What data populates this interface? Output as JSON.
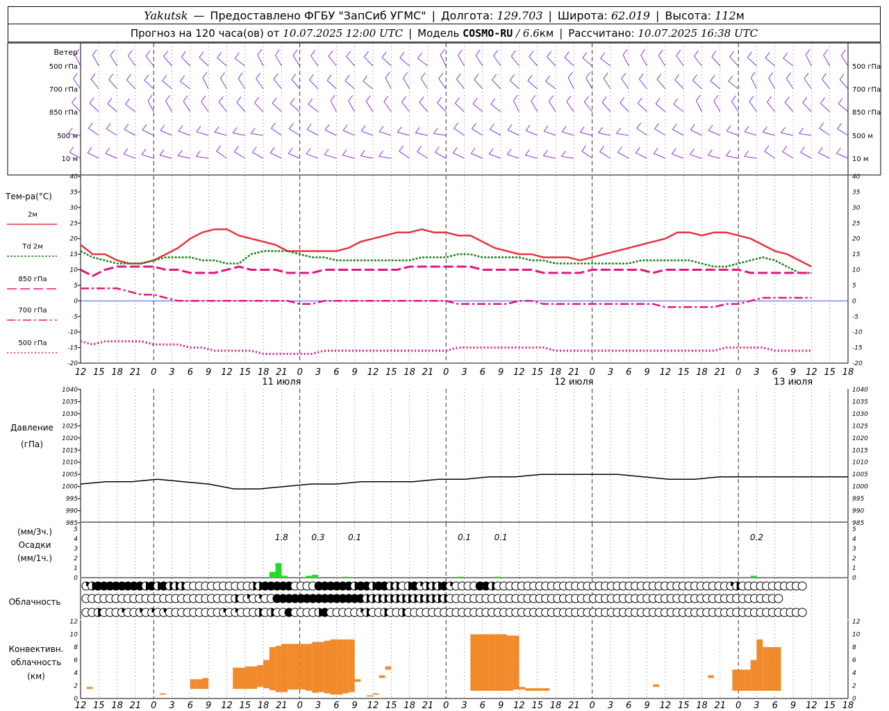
{
  "header": {
    "station": "Yakutsk",
    "dash": "—",
    "provider": "Предоставлено ФГБУ \"ЗапСиб УГМС\"",
    "lon_label": "Долгота:",
    "lon_value": "129.703",
    "lat_label": "Широта:",
    "lat_value": "62.019",
    "alt_label": "Высота:",
    "alt_value": "112",
    "alt_unit": "м",
    "forecast_label": "Прогноз на 120 часа(ов) от",
    "forecast_start": "10.07.2025 12:00 UTC",
    "model_label": "Модель",
    "model_name": "COSMO-RU",
    "model_res": "/ 6.6",
    "model_res_unit": "км",
    "calc_label": "Рассчитано:",
    "calc_time": "10.07.2025 16:38 UTC"
  },
  "colors": {
    "wind": "#8a2be2",
    "t2m": "#e8323c",
    "td2m": "#1a7f1a",
    "t850": "#e0157a",
    "t700": "#e0157a",
    "t500": "#e0157a",
    "zero_line": "#3030ff",
    "pressure": "#000000",
    "precip": "#22dd22",
    "convective": "#f08a2a",
    "grid": "#000000"
  },
  "wind_panel": {
    "title": "Ветер",
    "levels": [
      "500 гПа",
      "700 гПа",
      "850 гПа",
      "500  м",
      "10  м"
    ]
  },
  "temp_panel": {
    "title": "Тем-ра(°С)",
    "legend": [
      {
        "label": "2м",
        "style": "solid"
      },
      {
        "label": "Td  2м",
        "style": "dotted"
      },
      {
        "label": "850 гПа",
        "style": "dash"
      },
      {
        "label": "700 гПа",
        "style": "dashdot"
      },
      {
        "label": "500 гПа",
        "style": "fine"
      }
    ]
  },
  "pressure_panel": {
    "title": "Давление",
    "unit": "(гПа)"
  },
  "precip_panel": {
    "unit1": "(мм/3ч.)",
    "title": "Осадки",
    "unit2": "(мм/1ч.)"
  },
  "cloud_panel": {
    "title": "Облачность"
  },
  "conv_panel": {
    "title1": "Конвективн.",
    "title2": "облачность",
    "unit": "(км)"
  },
  "chart_data": {
    "type": "line",
    "x_hours": [
      0,
      3,
      6,
      9,
      12,
      15,
      18,
      21,
      24,
      27,
      30,
      33,
      36,
      39,
      42,
      45,
      48,
      51,
      54,
      57,
      60,
      63,
      66,
      69,
      72,
      75,
      78,
      81,
      84,
      87,
      90,
      93,
      96,
      99,
      102,
      105,
      108,
      111,
      114,
      117,
      120
    ],
    "x_tick_labels": [
      "12",
      "15",
      "18",
      "21",
      "0",
      "3",
      "6",
      "9",
      "12",
      "15",
      "18",
      "21",
      "0",
      "3",
      "6",
      "9",
      "12",
      "15",
      "18",
      "21",
      "0",
      "3",
      "6",
      "9",
      "12",
      "15",
      "18",
      "21",
      "0",
      "3",
      "6",
      "9",
      "12",
      "15",
      "18",
      "21",
      "0",
      "3",
      "6",
      "9",
      "12",
      "15",
      "18"
    ],
    "day_labels": [
      "11 июля",
      "12 июля",
      "13 июля"
    ],
    "temperature": {
      "ylim": [
        -20,
        40
      ],
      "yticks": [
        -20,
        -15,
        -10,
        -5,
        0,
        5,
        10,
        15,
        20,
        25,
        30,
        35,
        40
      ],
      "series": [
        {
          "name": "2м",
          "values": [
            18,
            15,
            15,
            13,
            12,
            12,
            13,
            15,
            17,
            20,
            22,
            23,
            23,
            21,
            20,
            19,
            18,
            16,
            16,
            16,
            16,
            16,
            17,
            19,
            20,
            21,
            22,
            22,
            23,
            22,
            22,
            21,
            21,
            19,
            17,
            16,
            15,
            15,
            14,
            14,
            14,
            13,
            14,
            15,
            16,
            17,
            18,
            19,
            20,
            22,
            22,
            21,
            22,
            22,
            21,
            20,
            18,
            16,
            15,
            13,
            11
          ]
        },
        {
          "name": "Td  2м",
          "values": [
            16,
            14,
            13,
            12,
            12,
            12,
            13,
            14,
            14,
            14,
            13,
            13,
            12,
            12,
            15,
            16,
            16,
            16,
            15,
            14,
            14,
            13,
            13,
            13,
            13,
            13,
            13,
            13,
            14,
            14,
            14,
            15,
            15,
            14,
            14,
            14,
            14,
            13,
            13,
            12,
            12,
            12,
            12,
            12,
            12,
            12,
            13,
            13,
            13,
            13,
            13,
            12,
            11,
            11,
            12,
            13,
            14,
            13,
            11,
            9,
            9
          ]
        },
        {
          "name": "850 гПа",
          "values": [
            10,
            8,
            10,
            11,
            11,
            11,
            11,
            10,
            10,
            9,
            9,
            9,
            10,
            11,
            10,
            10,
            10,
            9,
            9,
            9,
            10,
            10,
            10,
            10,
            10,
            10,
            10,
            11,
            11,
            11,
            11,
            11,
            11,
            10,
            10,
            10,
            10,
            10,
            9,
            9,
            9,
            9,
            10,
            10,
            10,
            10,
            10,
            9,
            10,
            10,
            10,
            10,
            10,
            10,
            10,
            9,
            9,
            9,
            9,
            9,
            9
          ]
        },
        {
          "name": "700 гПа",
          "values": [
            4,
            4,
            4,
            4,
            3,
            2,
            2,
            1,
            0,
            0,
            0,
            0,
            0,
            0,
            0,
            0,
            0,
            0,
            -1,
            -1,
            0,
            0,
            0,
            0,
            0,
            0,
            0,
            0,
            0,
            0,
            0,
            -1,
            -1,
            -1,
            -1,
            -1,
            0,
            0,
            -1,
            -1,
            -1,
            -1,
            -1,
            -1,
            -1,
            -1,
            -1,
            -1,
            -2,
            -2,
            -2,
            -2,
            -2,
            -1,
            -1,
            0,
            1,
            1,
            1,
            1,
            1
          ]
        },
        {
          "name": "500 гПа",
          "values": [
            -13,
            -14,
            -13,
            -13,
            -13,
            -13,
            -14,
            -14,
            -14,
            -15,
            -15,
            -16,
            -16,
            -16,
            -16,
            -17,
            -17,
            -17,
            -17,
            -17,
            -16,
            -16,
            -16,
            -16,
            -16,
            -16,
            -16,
            -16,
            -16,
            -16,
            -16,
            -15,
            -15,
            -15,
            -15,
            -15,
            -15,
            -15,
            -15,
            -16,
            -16,
            -16,
            -16,
            -16,
            -16,
            -16,
            -16,
            -16,
            -16,
            -16,
            -16,
            -16,
            -16,
            -15,
            -15,
            -15,
            -15,
            -16,
            -16,
            -16,
            -16
          ]
        }
      ]
    },
    "pressure": {
      "ylim": [
        985,
        1040
      ],
      "yticks": [
        985,
        990,
        995,
        1000,
        1005,
        1010,
        1015,
        1020,
        1025,
        1030,
        1035,
        1040
      ],
      "values": [
        1001,
        1002,
        1002,
        1003,
        1002,
        1001,
        999,
        999,
        1000,
        1001,
        1001,
        1002,
        1002,
        1002,
        1003,
        1003,
        1004,
        1004,
        1005,
        1005,
        1005,
        1005,
        1004,
        1003,
        1003,
        1004,
        1004,
        1004,
        1004,
        1004,
        1004
      ]
    },
    "precipitation": {
      "ylim": [
        0,
        5
      ],
      "yticks": [
        0,
        1,
        2,
        3,
        4,
        5
      ],
      "labels": [
        {
          "hour": 33,
          "text": "1.8"
        },
        {
          "hour": 39,
          "text": "0.3"
        },
        {
          "hour": 45,
          "text": "0.1"
        },
        {
          "hour": 63,
          "text": "0.1"
        },
        {
          "hour": 69,
          "text": "0.1"
        },
        {
          "hour": 111,
          "text": "0.2"
        }
      ],
      "hourly": [
        {
          "hour": 31,
          "value": 0.6
        },
        {
          "hour": 32,
          "value": 1.5
        },
        {
          "hour": 33,
          "value": 0.2
        },
        {
          "hour": 37,
          "value": 0.2
        },
        {
          "hour": 38,
          "value": 0.3
        },
        {
          "hour": 43,
          "value": 0.1
        },
        {
          "hour": 62,
          "value": 0.1
        },
        {
          "hour": 68,
          "value": 0.1
        },
        {
          "hour": 110,
          "value": 0.2
        }
      ]
    },
    "cloud_cover_octas": {
      "high": [
        2,
        5,
        8,
        8,
        8,
        8,
        8,
        8,
        8,
        8,
        4,
        8,
        4,
        8,
        6,
        5,
        4,
        0,
        0,
        0,
        0,
        0,
        0,
        0,
        0,
        0,
        0,
        0,
        4,
        4,
        8,
        8,
        8,
        8,
        8,
        0,
        0,
        0,
        0,
        8,
        8,
        8,
        8,
        8,
        8,
        4,
        8,
        8,
        4,
        8,
        8,
        4,
        4,
        0,
        4,
        8,
        2,
        4,
        6,
        6,
        8,
        2,
        0,
        0,
        0,
        0,
        8,
        8,
        4,
        0,
        0,
        0,
        0,
        0,
        0,
        0,
        0,
        0,
        0,
        0,
        0,
        0,
        0,
        0,
        0,
        0,
        0,
        0,
        0,
        0,
        0,
        0,
        0,
        0,
        0,
        0,
        0,
        0,
        0,
        0,
        0,
        0,
        0,
        0,
        0,
        0,
        0,
        0,
        2,
        4,
        0,
        0,
        0,
        0,
        0,
        0,
        0,
        0,
        0,
        0,
        0
      ],
      "mid": [
        0,
        0,
        0,
        0,
        0,
        0,
        0,
        0,
        0,
        0,
        0,
        0,
        0,
        0,
        0,
        0,
        0,
        0,
        0,
        0,
        0,
        0,
        0,
        0,
        0,
        4,
        0,
        2,
        0,
        2,
        0,
        0,
        8,
        8,
        8,
        8,
        8,
        8,
        8,
        8,
        8,
        8,
        8,
        8,
        8,
        8,
        8,
        4,
        4,
        4,
        4,
        4,
        4,
        4,
        4,
        4,
        4,
        4,
        4,
        4,
        4,
        0,
        0,
        0,
        0,
        0,
        0,
        0,
        0,
        0,
        0,
        0,
        0,
        0,
        0,
        0,
        0,
        0,
        0,
        0,
        0,
        0,
        0,
        0,
        0,
        0,
        0,
        0,
        0,
        0,
        0,
        0,
        0,
        0,
        0,
        0,
        0,
        0,
        0,
        0,
        0,
        0,
        0,
        0,
        0,
        0,
        0,
        0,
        0,
        0,
        0,
        0,
        0,
        0,
        0,
        0,
        0
      ],
      "low": [
        0,
        0,
        4,
        0,
        0,
        0,
        2,
        0,
        0,
        2,
        0,
        2,
        0,
        2,
        0,
        0,
        0,
        0,
        0,
        0,
        0,
        0,
        0,
        2,
        0,
        2,
        0,
        0,
        0,
        4,
        0,
        4,
        0,
        0,
        8,
        0,
        0,
        0,
        0,
        4,
        8,
        0,
        0,
        0,
        0,
        0,
        2,
        4,
        0,
        0,
        4,
        0,
        0,
        4,
        0,
        0,
        0,
        0,
        0,
        0,
        0,
        0,
        0,
        0,
        0,
        0,
        0,
        0,
        0,
        0,
        0,
        0,
        0,
        0,
        0,
        0,
        0,
        0,
        0,
        0,
        0,
        0,
        0,
        0,
        0,
        0,
        0,
        0,
        0,
        0,
        0,
        0,
        0,
        0,
        0,
        0,
        0,
        0,
        0,
        0,
        0,
        0,
        0,
        0,
        0,
        0,
        0,
        0,
        0,
        0,
        0,
        0,
        0,
        0,
        0,
        0,
        0,
        0,
        0,
        0,
        0
      ]
    },
    "convective_cloud": {
      "ylim": [
        0,
        12
      ],
      "yticks": [
        0,
        2,
        4,
        6,
        8,
        10,
        12
      ],
      "layers": [
        {
          "hour": 1,
          "base": 1.5,
          "top": 1.8
        },
        {
          "hour": 13,
          "base": 0.6,
          "top": 0.8
        },
        {
          "hour": 18,
          "base": 1.5,
          "top": 3.0
        },
        {
          "hour": 19,
          "base": 1.5,
          "top": 3.0
        },
        {
          "hour": 20,
          "base": 1.5,
          "top": 3.2
        },
        {
          "hour": 25,
          "base": 1.5,
          "top": 4.8
        },
        {
          "hour": 26,
          "base": 1.5,
          "top": 4.8
        },
        {
          "hour": 27,
          "base": 1.5,
          "top": 5.0
        },
        {
          "hour": 28,
          "base": 1.5,
          "top": 5.0
        },
        {
          "hour": 29,
          "base": 1.8,
          "top": 5.2
        },
        {
          "hour": 30,
          "base": 1.6,
          "top": 6.0
        },
        {
          "hour": 31,
          "base": 1.3,
          "top": 8.0
        },
        {
          "hour": 32,
          "base": 1.0,
          "top": 8.2
        },
        {
          "hour": 33,
          "base": 1.0,
          "top": 8.5
        },
        {
          "hour": 34,
          "base": 1.4,
          "top": 8.5
        },
        {
          "hour": 35,
          "base": 1.4,
          "top": 8.5
        },
        {
          "hour": 36,
          "base": 1.4,
          "top": 8.5
        },
        {
          "hour": 37,
          "base": 1.2,
          "top": 8.5
        },
        {
          "hour": 38,
          "base": 0.9,
          "top": 8.8
        },
        {
          "hour": 39,
          "base": 1.0,
          "top": 8.8
        },
        {
          "hour": 40,
          "base": 0.8,
          "top": 9.0
        },
        {
          "hour": 41,
          "base": 0.6,
          "top": 9.2
        },
        {
          "hour": 42,
          "base": 0.6,
          "top": 9.2
        },
        {
          "hour": 43,
          "base": 0.8,
          "top": 9.2
        },
        {
          "hour": 44,
          "base": 1.0,
          "top": 9.2
        },
        {
          "hour": 45,
          "base": 2.6,
          "top": 3.0
        },
        {
          "hour": 47,
          "base": 0.3,
          "top": 0.5
        },
        {
          "hour": 48,
          "base": 0.6,
          "top": 0.8
        },
        {
          "hour": 49,
          "base": 3.2,
          "top": 3.6
        },
        {
          "hour": 50,
          "base": 4.5,
          "top": 5.0
        },
        {
          "hour": 64,
          "base": 1.2,
          "top": 10.0
        },
        {
          "hour": 65,
          "base": 1.2,
          "top": 10.0
        },
        {
          "hour": 66,
          "base": 1.2,
          "top": 10.0
        },
        {
          "hour": 67,
          "base": 1.2,
          "top": 10.0
        },
        {
          "hour": 68,
          "base": 1.2,
          "top": 10.0
        },
        {
          "hour": 69,
          "base": 1.2,
          "top": 10.0
        },
        {
          "hour": 70,
          "base": 1.2,
          "top": 9.8
        },
        {
          "hour": 71,
          "base": 1.4,
          "top": 9.8
        },
        {
          "hour": 72,
          "base": 1.4,
          "top": 1.8
        },
        {
          "hour": 73,
          "base": 1.2,
          "top": 1.6
        },
        {
          "hour": 74,
          "base": 1.2,
          "top": 1.6
        },
        {
          "hour": 75,
          "base": 1.2,
          "top": 1.6
        },
        {
          "hour": 76,
          "base": 1.2,
          "top": 1.6
        },
        {
          "hour": 94,
          "base": 1.8,
          "top": 2.2
        },
        {
          "hour": 103,
          "base": 3.2,
          "top": 3.6
        },
        {
          "hour": 107,
          "base": 1.2,
          "top": 4.5
        },
        {
          "hour": 108,
          "base": 1.2,
          "top": 4.5
        },
        {
          "hour": 109,
          "base": 1.2,
          "top": 4.5
        },
        {
          "hour": 110,
          "base": 1.2,
          "top": 6.0
        },
        {
          "hour": 111,
          "base": 1.2,
          "top": 9.2
        },
        {
          "hour": 112,
          "base": 1.2,
          "top": 8.0
        },
        {
          "hour": 113,
          "base": 1.2,
          "top": 8.0
        },
        {
          "hour": 114,
          "base": 1.2,
          "top": 8.0
        }
      ]
    }
  }
}
